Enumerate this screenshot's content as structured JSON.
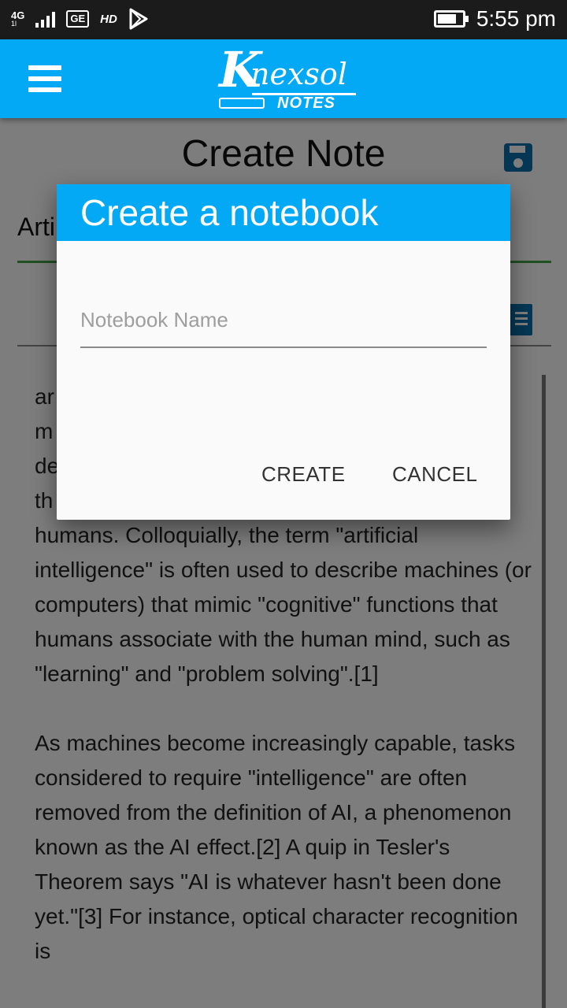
{
  "status_bar": {
    "network": "4G",
    "network_sub": "1l",
    "ge_badge": "GE",
    "hd": "HD",
    "time": "5:55 pm",
    "battery_level": 0.75
  },
  "app_bar": {
    "logo_title": "nexsol",
    "logo_initial": "K",
    "logo_subtitle": "NOTES"
  },
  "screen": {
    "title": "Create Note",
    "note_title_value": "Arti",
    "body_text": "ar                                                        d\nm\nde\nth\nhumans. Colloquially, the term \"artificial intelligence\" is often used to describe machines (or computers) that mimic \"cognitive\" functions that humans associate with the human mind, such as \"learning\" and \"problem solving\".[1]\n\nAs machines become increasingly capable, tasks considered to require \"intelligence\" are often removed from the definition of AI, a phenomenon known as the AI effect.[2] A quip in Tesler's Theorem says \"AI is whatever hasn't been done yet.\"[3] For instance, optical character recognition is"
  },
  "dialog": {
    "title": "Create a notebook",
    "input_placeholder": "Notebook Name",
    "input_value": "",
    "create_label": "CREATE",
    "cancel_label": "CANCEL"
  },
  "colors": {
    "primary": "#03a9f4",
    "icon_blue": "#0b6ea8",
    "accent_green": "#43a047"
  }
}
